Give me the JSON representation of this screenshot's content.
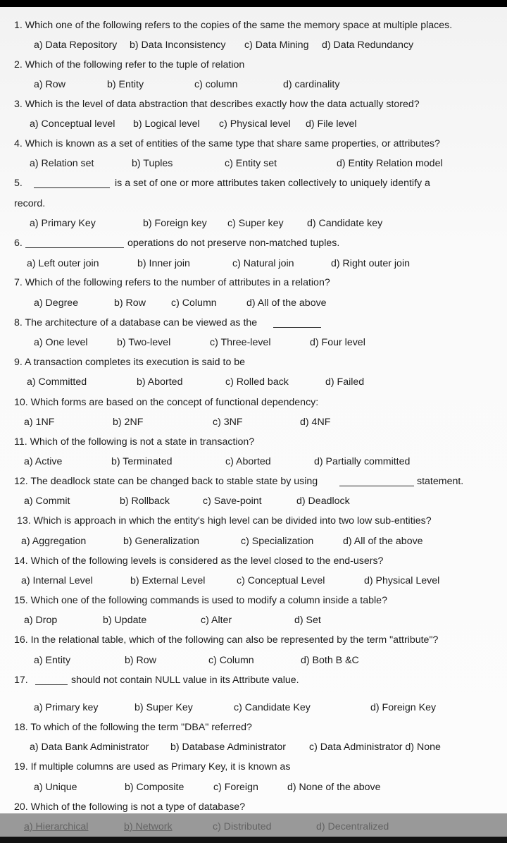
{
  "questions": [
    {
      "q": "1. Which one of the following refers to the copies of the same the memory space at multiple places.",
      "opts": [
        "a) Data Repository",
        "b) Data Inconsistency",
        "c) Data Mining",
        "d) Data Redundancy"
      ]
    },
    {
      "q": "2. Which of the following refer to the tuple of relation",
      "opts": [
        "a) Row",
        "b) Entity",
        "c) column",
        "d) cardinality"
      ]
    },
    {
      "q": "3. Which is the level of data abstraction that describes exactly how the data actually stored?",
      "opts": [
        "a) Conceptual level",
        "b) Logical level",
        "c) Physical level",
        "d) File level"
      ]
    },
    {
      "q": "4.  Which is known as a set of entities of the same type that share same properties, or attributes?",
      "opts": [
        "a) Relation set",
        "b) Tuples",
        "c) Entity set",
        "d) Entity Relation model"
      ]
    },
    {
      "num": "5.",
      "q": "is a set of one or more attributes taken collectively to uniquely identify a",
      "cont": "record.",
      "opts": [
        "a) Primary Key",
        "b) Foreign key",
        "c) Super key",
        "d) Candidate key"
      ]
    },
    {
      "num": "6.",
      "q": "operations do not preserve non-matched tuples.",
      "opts": [
        "a) Left outer join",
        "b) Inner join",
        "c) Natural join",
        "d) Right outer join"
      ]
    },
    {
      "q": "7. Which of the following refers to the number of attributes in a relation?",
      "opts": [
        "a) Degree",
        "b) Row",
        "c) Column",
        "d) All of the above"
      ]
    },
    {
      "q": "8. The architecture of a database can be viewed as the",
      "opts": [
        "a) One level",
        "b) Two-level",
        "c) Three-level",
        "d) Four level"
      ]
    },
    {
      "q": "9.  A transaction completes its execution is said to be",
      "opts": [
        "a) Committed",
        "b) Aborted",
        "c) Rolled back",
        "d) Failed"
      ]
    },
    {
      "q": "10.  Which forms are based on the concept of functional dependency:",
      "opts": [
        "a) 1NF",
        "b) 2NF",
        "c) 3NF",
        "d) 4NF"
      ]
    },
    {
      "q": "11. Which of the following is not a state in transaction?",
      "opts": [
        "a) Active",
        "b) Terminated",
        "c) Aborted",
        "d) Partially committed"
      ]
    },
    {
      "q": "12.  The deadlock state can be changed back to stable state by using",
      "tail": "statement.",
      "opts": [
        "a) Commit",
        "b) Rollback",
        "c) Save-point",
        "d) Deadlock"
      ]
    },
    {
      "q": "13. Which is approach in which the entity's high level can be divided into two low sub-entities?",
      "opts": [
        "a) Aggregation",
        "b) Generalization",
        "c) Specialization",
        "d)  All of the above"
      ]
    },
    {
      "q": "14. Which of the following levels is considered as the level closed to the end-users?",
      "opts": [
        "a) Internal Level",
        "b) External Level",
        "c)  Conceptual Level",
        "d) Physical Level"
      ]
    },
    {
      "q": "15.  Which one of the following commands is used to modify a column inside a table?",
      "opts": [
        "a) Drop",
        "b) Update",
        "c) Alter",
        "d)  Set"
      ]
    },
    {
      "q": "16. In the relational table, which of the following can also be represented by the term \"attribute\"?",
      "opts": [
        "a) Entity",
        "b) Row",
        "c) Column",
        "d) Both B &C"
      ]
    },
    {
      "num": "17.",
      "q": "should not contain NULL value in its Attribute value.",
      "opts": [
        "a) Primary key",
        "b) Super Key",
        "c)  Candidate Key",
        "d) Foreign Key"
      ]
    },
    {
      "q": "18. To which of the following the term \"DBA\" referred?",
      "opts": [
        "a) Data Bank Administrator",
        "b) Database Administrator",
        "c) Data Administrator d) None"
      ]
    },
    {
      "q": "19.  If multiple columns are used as Primary Key, it is known as",
      "opts": [
        "a) Unique",
        "b) Composite",
        "c) Foreign",
        "d) None of the above"
      ]
    },
    {
      "q": "20. Which of the following is not a type of database?",
      "opts": [
        "a) Hierarchical",
        "b) Network",
        "c) Distributed",
        "d) Decentralized"
      ]
    }
  ]
}
